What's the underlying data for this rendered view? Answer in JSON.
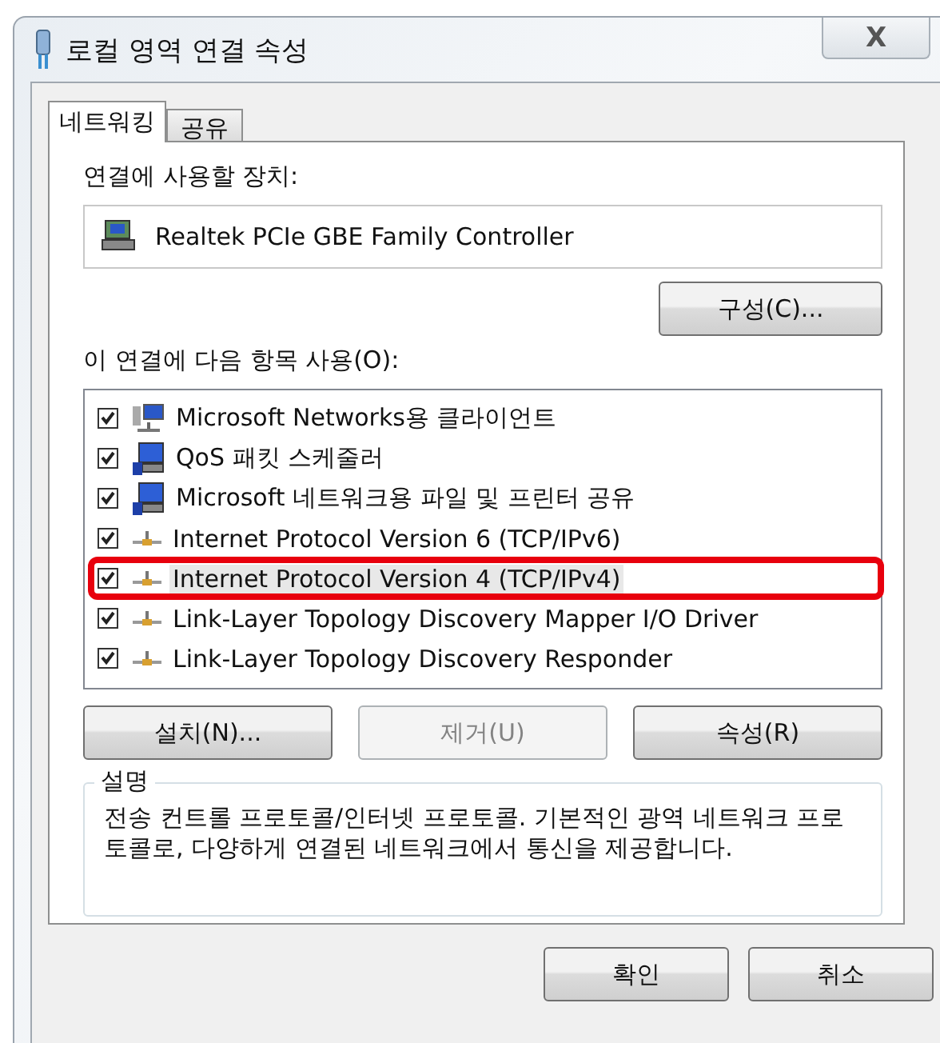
{
  "window": {
    "title": "로컬 영역 연결 속성",
    "close": "X"
  },
  "tabs": [
    {
      "label": "네트워킹",
      "selected": true
    },
    {
      "label": "공유",
      "selected": false
    }
  ],
  "device": {
    "label": "연결에 사용할 장치:",
    "name": "Realtek PCIe GBE Family Controller",
    "configure_button": "구성(C)..."
  },
  "items_label": "이 연결에 다음 항목 사용(O):",
  "items": [
    {
      "kind": "client",
      "label": "Microsoft Networks용 클라이언트",
      "checked": true,
      "selected": false,
      "annotated": false
    },
    {
      "kind": "service",
      "label": "QoS 패킷 스케줄러",
      "checked": true,
      "selected": false,
      "annotated": false
    },
    {
      "kind": "service",
      "label": "Microsoft 네트워크용 파일 및 프린터 공유",
      "checked": true,
      "selected": false,
      "annotated": false
    },
    {
      "kind": "protocol",
      "label": "Internet Protocol Version 6 (TCP/IPv6)",
      "checked": true,
      "selected": false,
      "annotated": false
    },
    {
      "kind": "protocol",
      "label": "Internet Protocol Version 4 (TCP/IPv4)",
      "checked": true,
      "selected": true,
      "annotated": true
    },
    {
      "kind": "protocol",
      "label": "Link-Layer Topology Discovery Mapper I/O Driver",
      "checked": true,
      "selected": false,
      "annotated": false
    },
    {
      "kind": "protocol",
      "label": "Link-Layer Topology Discovery Responder",
      "checked": true,
      "selected": false,
      "annotated": false
    }
  ],
  "item_buttons": [
    {
      "label": "설치(N)...",
      "disabled": false
    },
    {
      "label": "제거(U)",
      "disabled": true
    },
    {
      "label": "속성(R)",
      "disabled": false
    }
  ],
  "description": {
    "title": "설명",
    "text": "전송 컨트롤 프로토콜/인터넷 프로토콜. 기본적인 광역 네트워크 프로토콜로, 다양하게 연결된 네트워크에서 통신을 제공합니다."
  },
  "dialog_buttons": [
    {
      "label": "확인"
    },
    {
      "label": "취소"
    }
  ]
}
